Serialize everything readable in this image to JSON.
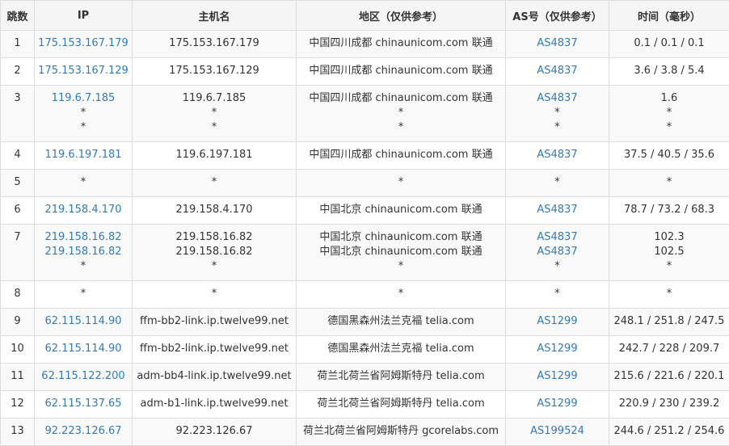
{
  "table": {
    "headers": [
      "跳数",
      "IP",
      "主机名",
      "地区（仅供参考）",
      "AS号（仅供参考）",
      "时间（毫秒）"
    ],
    "rows": [
      {
        "hop": "1",
        "ip": [
          "175.153.167.179"
        ],
        "host": [
          "175.153.167.179"
        ],
        "loc": [
          "中国四川成都 chinaunicom.com 联通"
        ],
        "as": [
          "AS4837"
        ],
        "time": [
          "0.1 / 0.1 / 0.1"
        ]
      },
      {
        "hop": "2",
        "ip": [
          "175.153.167.129"
        ],
        "host": [
          "175.153.167.129"
        ],
        "loc": [
          "中国四川成都 chinaunicom.com 联通"
        ],
        "as": [
          "AS4837"
        ],
        "time": [
          "3.6 / 3.8 / 5.4"
        ]
      },
      {
        "hop": "3",
        "ip": [
          "119.6.7.185",
          "*",
          "*"
        ],
        "host": [
          "119.6.7.185",
          "*",
          "*"
        ],
        "loc": [
          "中国四川成都 chinaunicom.com 联通",
          "*",
          "*"
        ],
        "as": [
          "AS4837",
          "*",
          "*"
        ],
        "time": [
          "1.6",
          "*",
          "*"
        ]
      },
      {
        "hop": "4",
        "ip": [
          "119.6.197.181"
        ],
        "host": [
          "119.6.197.181"
        ],
        "loc": [
          "中国四川成都 chinaunicom.com 联通"
        ],
        "as": [
          "AS4837"
        ],
        "time": [
          "37.5 / 40.5 / 35.6"
        ]
      },
      {
        "hop": "5",
        "ip": [
          "*"
        ],
        "host": [
          "*"
        ],
        "loc": [
          "*"
        ],
        "as": [
          "*"
        ],
        "time": [
          "*"
        ]
      },
      {
        "hop": "6",
        "ip": [
          "219.158.4.170"
        ],
        "host": [
          "219.158.4.170"
        ],
        "loc": [
          "中国北京 chinaunicom.com 联通"
        ],
        "as": [
          "AS4837"
        ],
        "time": [
          "78.7 / 73.2 / 68.3"
        ]
      },
      {
        "hop": "7",
        "ip": [
          "219.158.16.82",
          "219.158.16.82",
          "*"
        ],
        "host": [
          "219.158.16.82",
          "219.158.16.82",
          "*"
        ],
        "loc": [
          "中国北京 chinaunicom.com 联通",
          "中国北京 chinaunicom.com 联通",
          "*"
        ],
        "as": [
          "AS4837",
          "AS4837",
          "*"
        ],
        "time": [
          "102.3",
          "102.5",
          "*"
        ]
      },
      {
        "hop": "8",
        "ip": [
          "*"
        ],
        "host": [
          "*"
        ],
        "loc": [
          "*"
        ],
        "as": [
          "*"
        ],
        "time": [
          "*"
        ]
      },
      {
        "hop": "9",
        "ip": [
          "62.115.114.90"
        ],
        "host": [
          "ffm-bb2-link.ip.twelve99.net"
        ],
        "loc": [
          "德国黑森州法兰克福 telia.com"
        ],
        "as": [
          "AS1299"
        ],
        "time": [
          "248.1 / 251.8 / 247.5"
        ]
      },
      {
        "hop": "10",
        "ip": [
          "62.115.114.90"
        ],
        "host": [
          "ffm-bb2-link.ip.twelve99.net"
        ],
        "loc": [
          "德国黑森州法兰克福 telia.com"
        ],
        "as": [
          "AS1299"
        ],
        "time": [
          "242.7 / 228 / 209.7"
        ]
      },
      {
        "hop": "11",
        "ip": [
          "62.115.122.200"
        ],
        "host": [
          "adm-bb4-link.ip.twelve99.net"
        ],
        "loc": [
          "荷兰北荷兰省阿姆斯特丹 telia.com"
        ],
        "as": [
          "AS1299"
        ],
        "time": [
          "215.6 / 221.6 / 220.1"
        ]
      },
      {
        "hop": "12",
        "ip": [
          "62.115.137.65"
        ],
        "host": [
          "adm-b1-link.ip.twelve99.net"
        ],
        "loc": [
          "荷兰北荷兰省阿姆斯特丹 telia.com"
        ],
        "as": [
          "AS1299"
        ],
        "time": [
          "220.9 / 230 / 239.2"
        ]
      },
      {
        "hop": "13",
        "ip": [
          "92.223.126.67"
        ],
        "host": [
          "92.223.126.67"
        ],
        "loc": [
          "荷兰北荷兰省阿姆斯特丹 gcorelabs.com"
        ],
        "as": [
          "AS199524"
        ],
        "time": [
          "244.6 / 251.2 / 254.6"
        ]
      }
    ]
  },
  "colors": {
    "link": "#337ab7",
    "text": "#333333",
    "border": "#dddddd",
    "header_bg": "#f5f5f5",
    "stripe_bg": "#f9f9f9"
  }
}
